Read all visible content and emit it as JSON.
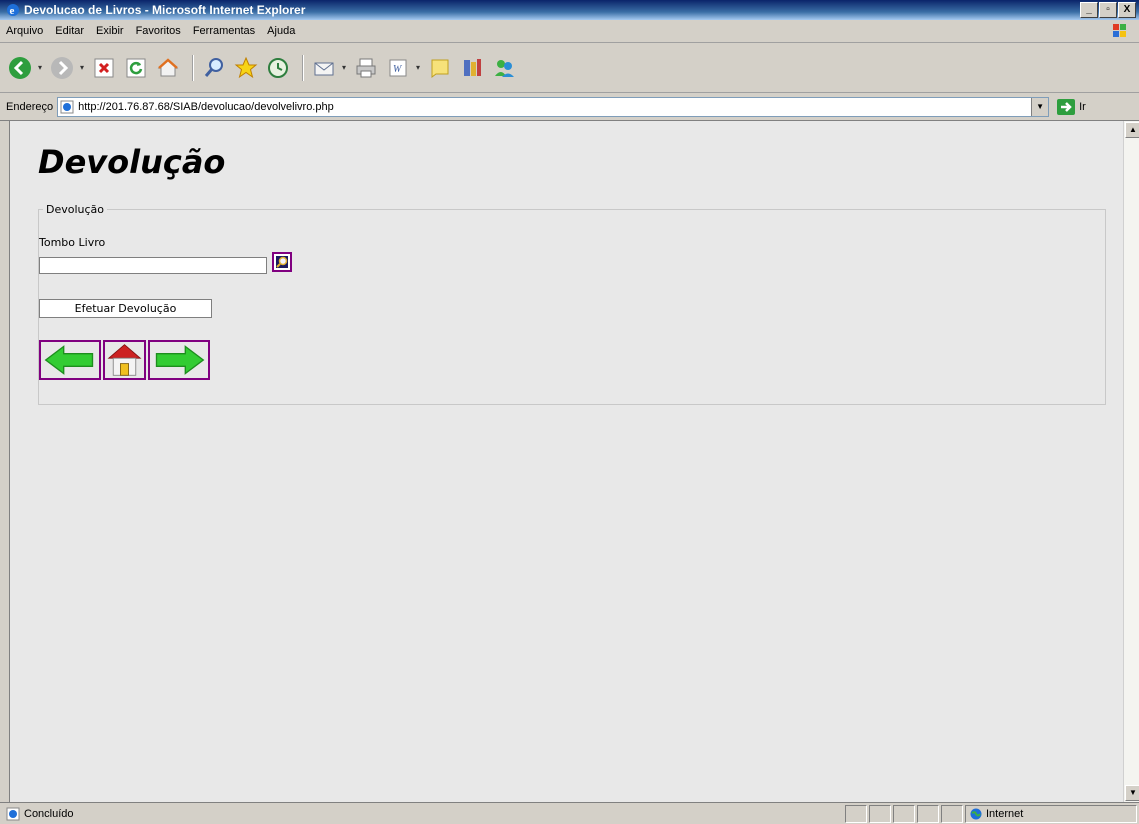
{
  "window": {
    "title": "Devolucao de Livros - Microsoft Internet Explorer",
    "min": "_",
    "max": "▫",
    "close": "X"
  },
  "menu": [
    "Arquivo",
    "Editar",
    "Exibir",
    "Favoritos",
    "Ferramentas",
    "Ajuda"
  ],
  "toolbar_icons": [
    "back-icon",
    "forward-icon",
    "stop-icon",
    "refresh-icon",
    "home-icon",
    "search-icon",
    "favorites-icon",
    "history-icon",
    "mail-icon",
    "print-icon",
    "edit-word-icon",
    "discuss-icon",
    "research-icon",
    "messenger-icon"
  ],
  "address": {
    "label": "Endereço",
    "url": "http://201.76.87.68/SIAB/devolucao/devolvelivro.php",
    "go": "Ir"
  },
  "page": {
    "title": "Devolução",
    "fieldset_legend": "Devolução",
    "tombo_label": "Tombo Livro",
    "tombo_value": "",
    "submit_label": "Efetuar Devolução"
  },
  "status": {
    "text": "Concluído",
    "zone": "Internet"
  },
  "colors": {
    "titlebar": "#0a246a",
    "page_bg": "#e8e8e8",
    "nav_border": "#800080",
    "arrow_green": "#33cc33",
    "home_red": "#cc2222"
  }
}
